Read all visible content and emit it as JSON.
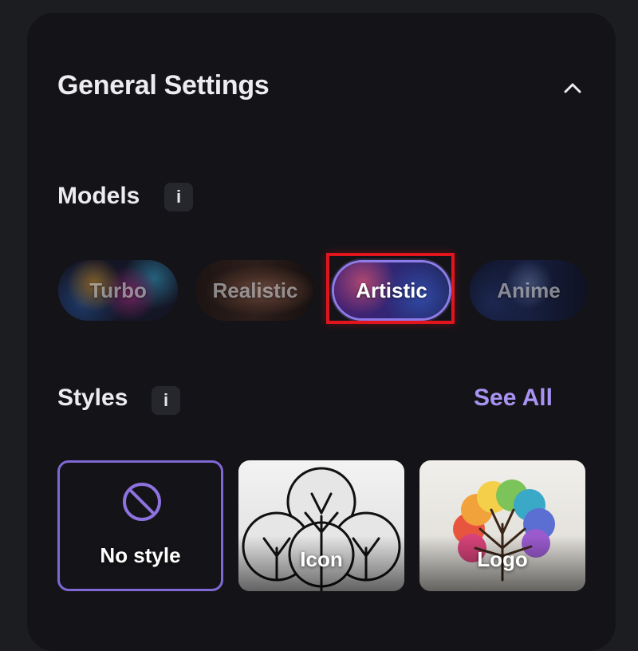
{
  "settings": {
    "title": "General Settings",
    "collapse_icon": "chevron-up-icon"
  },
  "models": {
    "label": "Models",
    "info_label": "i",
    "items": [
      {
        "label": "Turbo",
        "selected": false
      },
      {
        "label": "Realistic",
        "selected": false
      },
      {
        "label": "Artistic",
        "selected": true
      },
      {
        "label": "Anime",
        "selected": false
      }
    ]
  },
  "styles": {
    "label": "Styles",
    "info_label": "i",
    "see_all_label": "See All",
    "items": [
      {
        "label": "No style",
        "icon": "no-style-icon",
        "selected": true
      },
      {
        "label": "Icon",
        "selected": false
      },
      {
        "label": "Logo",
        "selected": false
      }
    ]
  },
  "colors": {
    "background": "#141418",
    "accent": "#8e7be8",
    "see_all": "#a993f2",
    "highlight": "#e0151d"
  }
}
